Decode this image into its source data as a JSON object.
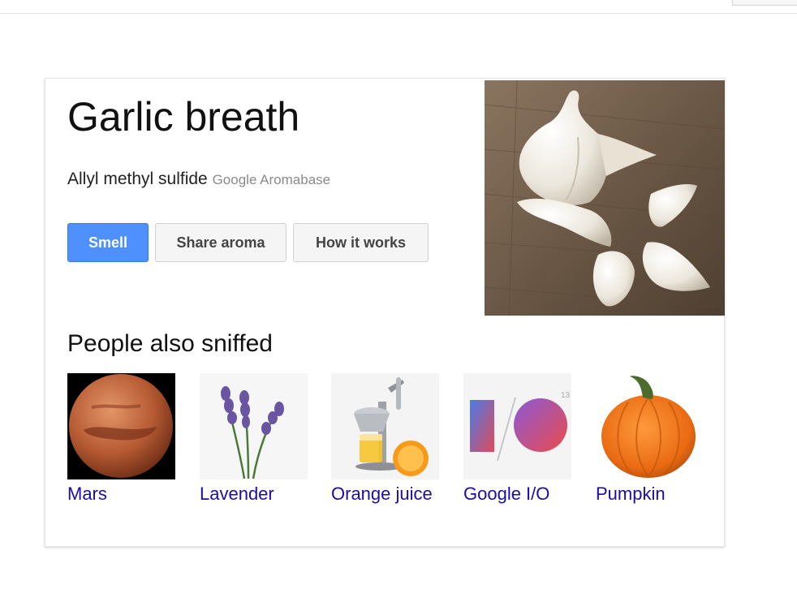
{
  "knowledge_card": {
    "title": "Garlic breath",
    "subtitle": "Allyl methyl sulfide",
    "source": "Google Aromabase",
    "buttons": {
      "smell": "Smell",
      "share": "Share aroma",
      "how": "How it works"
    },
    "hero_image": "garlic-bulb-and-cloves-on-wood",
    "related_heading": "People also sniffed",
    "related_items": [
      {
        "label": "Mars",
        "image": "planet-mars"
      },
      {
        "label": "Lavender",
        "image": "lavender-sprigs"
      },
      {
        "label": "Orange juice",
        "image": "citrus-juicer-with-orange"
      },
      {
        "label": "Google I/O",
        "image": "google-io-logo"
      },
      {
        "label": "Pumpkin",
        "image": "orange-pumpkin"
      }
    ],
    "google_io_badge": "13"
  },
  "colors": {
    "link": "#1a0dab",
    "primary_button": "#4d90fe",
    "secondary_button": "#f5f5f5"
  }
}
